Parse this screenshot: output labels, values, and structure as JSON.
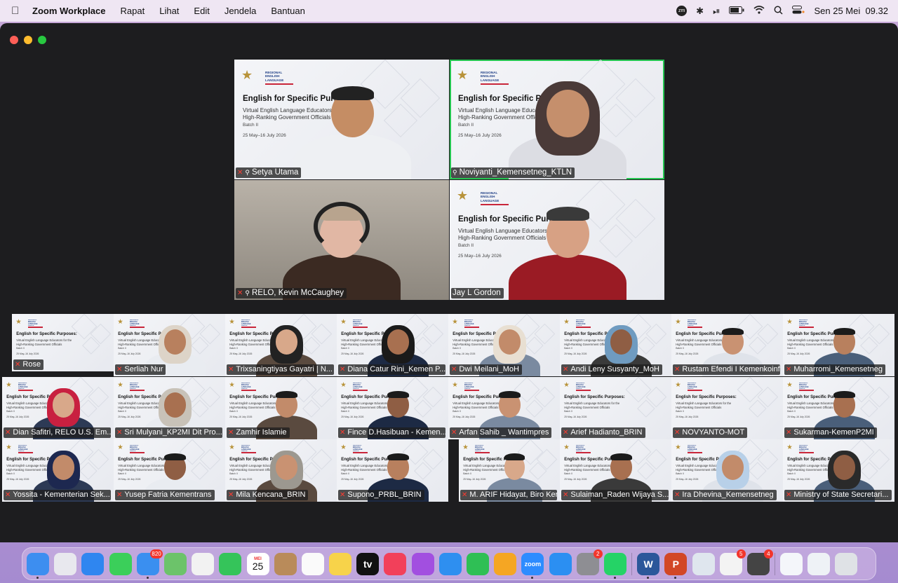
{
  "menubar": {
    "app_name": "Zoom Workplace",
    "menus": [
      "Rapat",
      "Lihat",
      "Edit",
      "Jendela",
      "Bantuan"
    ],
    "clock": "Sen 25 Mei  09.32",
    "status_icons": [
      "zoom-icon",
      "bluetooth-icon",
      "play-icon",
      "battery-icon",
      "wifi-icon",
      "search-icon",
      "control-center-icon"
    ]
  },
  "slide": {
    "org": "REGIONAL ENGLISH LANGUAGE OFFICE",
    "title": "English for Specific Purposes:",
    "subtitle1": "Virtual English Language Educators for the",
    "subtitle2": "High-Ranking Government Officials",
    "batch": "Batch II",
    "dates": "25 May–16 July 2026"
  },
  "main_tiles": [
    {
      "name": "Setya Utama",
      "muted": true,
      "pinned": true,
      "speaking": false
    },
    {
      "name": "Noviyanti_Kemensetneg_KTLN",
      "muted": false,
      "pinned": true,
      "speaking": true
    },
    {
      "name": "RELO, Kevin McCaughey",
      "muted": true,
      "pinned": true,
      "speaking": false
    },
    {
      "name": "Jay L Gordon",
      "muted": false,
      "pinned": false,
      "speaking": false
    }
  ],
  "gallery": [
    {
      "name": "Rose"
    },
    {
      "name": "Serliah Nur"
    },
    {
      "name": "Trixsaningtiyas Gayatri | N..."
    },
    {
      "name": "Diana Catur Rini_Kemen P..."
    },
    {
      "name": "Dwi Meilani_MoH"
    },
    {
      "name": "Andi Leny Susyanty_MoH"
    },
    {
      "name": "Rustam Efendi I Kemenkoinfra"
    },
    {
      "name": "Muharromi_Kemensetneg"
    },
    {
      "name": "Dian Safitri, RELO U.S. Em..."
    },
    {
      "name": "Sri Mulyani_KP2MI Dit Pro..."
    },
    {
      "name": "Zamhir Islamie"
    },
    {
      "name": "Fince D.Hasibuan - Kemen..."
    },
    {
      "name": "Arfan Sahib _ Wantimpres"
    },
    {
      "name": "Arief Hadianto_BRIN"
    },
    {
      "name": "NOVYANTO-MOT"
    },
    {
      "name": "Sukarman-KemenP2MI"
    },
    {
      "name": "Yossita - Kementerian Sek..."
    },
    {
      "name": "Yusep Fatria Kementrans"
    },
    {
      "name": "Mila Kencana_BRIN"
    },
    {
      "name": "Supono_PRBL_BRIN"
    },
    {
      "name": "M. ARIF Hidayat, Biro Kerj..."
    },
    {
      "name": "Sulaiman_Raden Wijaya S..."
    },
    {
      "name": "Ira Dhevina_Kemensetneg"
    },
    {
      "name": "Ministry of State Secretari..."
    }
  ],
  "dock": [
    {
      "icon": "finder-icon",
      "color": "#3d8ef0"
    },
    {
      "icon": "launchpad-icon",
      "color": "#e8e8ee"
    },
    {
      "icon": "safari-icon",
      "color": "#2f86f0"
    },
    {
      "icon": "messages-icon",
      "color": "#3bcf5a"
    },
    {
      "icon": "mail-icon",
      "color": "#3a8ff0",
      "badge": "820"
    },
    {
      "icon": "maps-icon",
      "color": "#6cc36a"
    },
    {
      "icon": "photos-icon",
      "color": "#f2f2f2"
    },
    {
      "icon": "facetime-icon",
      "color": "#35c45a"
    },
    {
      "icon": "calendar-icon",
      "color": "#ffffff",
      "month": "MEI",
      "day": "25"
    },
    {
      "icon": "contacts-icon",
      "color": "#b98b5a"
    },
    {
      "icon": "reminders-icon",
      "color": "#fafafa"
    },
    {
      "icon": "notes-icon",
      "color": "#f7d34a"
    },
    {
      "icon": "tv-icon",
      "color": "#111111",
      "label": "tv"
    },
    {
      "icon": "music-icon",
      "color": "#f2405a"
    },
    {
      "icon": "podcasts-icon",
      "color": "#a24fe0"
    },
    {
      "icon": "keynote-icon",
      "color": "#2e8ff0"
    },
    {
      "icon": "numbers-icon",
      "color": "#2fbf55"
    },
    {
      "icon": "pages-icon",
      "color": "#f5a623"
    },
    {
      "icon": "zoom-icon",
      "color": "#2d8cff",
      "label": "zoom"
    },
    {
      "icon": "app-store-icon",
      "color": "#2b8ff2"
    },
    {
      "icon": "system-settings-icon",
      "color": "#8e8e93",
      "badge": "2"
    },
    {
      "icon": "whatsapp-icon",
      "color": "#25d366"
    },
    {
      "icon": "word-icon",
      "color": "#2b579a",
      "label": "W"
    },
    {
      "icon": "powerpoint-icon",
      "color": "#d24726",
      "label": "P"
    },
    {
      "icon": "preview-icon",
      "color": "#dfe6ee"
    },
    {
      "icon": "microsoft-store-icon",
      "color": "#f3f3f3",
      "badge": "5"
    },
    {
      "icon": "piano-icon",
      "color": "#444444",
      "badge": "4"
    },
    {
      "icon": "documents-icon",
      "color": "#f4f6fa"
    },
    {
      "icon": "downloads-icon",
      "color": "#eef2f6"
    },
    {
      "icon": "trash-icon",
      "color": "#dfe2e6"
    }
  ]
}
